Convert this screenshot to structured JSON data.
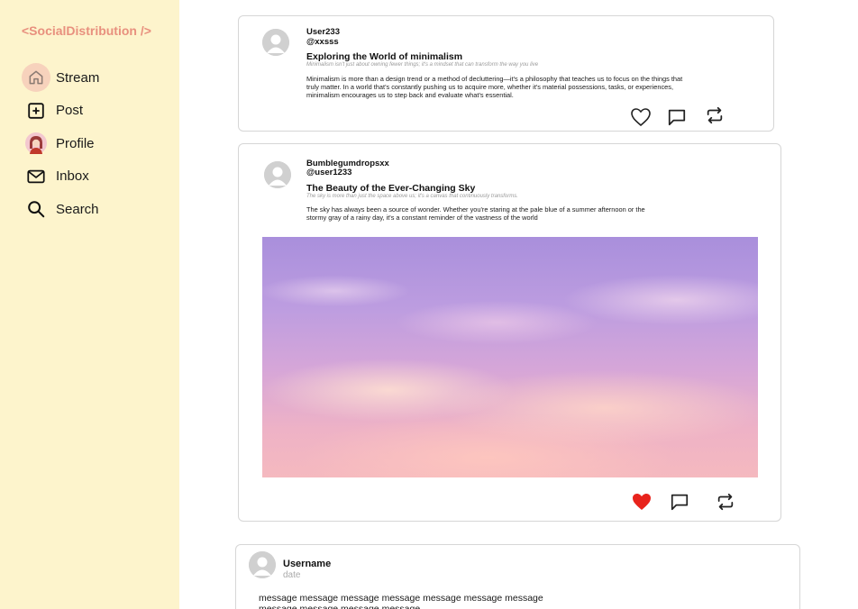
{
  "app": {
    "brand": "<SocialDistribution />"
  },
  "nav": {
    "items": [
      {
        "label": "Stream",
        "icon": "home-icon",
        "active": true
      },
      {
        "label": "Post",
        "icon": "plus-square-icon"
      },
      {
        "label": "Profile",
        "icon": "profile-avatar-icon"
      },
      {
        "label": "Inbox",
        "icon": "mail-icon"
      },
      {
        "label": "Search",
        "icon": "search-icon"
      }
    ]
  },
  "posts": [
    {
      "display_name": "User233",
      "handle": "@xxsss",
      "title": "Exploring the World of minimalism",
      "subtitle": "Minimalism isn't just about owning fewer things; it's a mindset that can transform the way you live",
      "body": "Minimalism is more than a design trend or a method of decluttering—it's a philosophy that teaches us to focus on the things that truly matter. In a world that's constantly pushing us to acquire more, whether it's material possessions, tasks, or experiences, minimalism encourages us to step back and evaluate what's essential.",
      "liked": false
    },
    {
      "display_name": "Bumblegumdropsxx",
      "handle": "@user1233",
      "title": "The Beauty of the Ever-Changing Sky",
      "subtitle": "The sky is more than just the space above us; it's a canvas that continuously transforms.",
      "body": "The sky has always been a source of wonder. Whether you're staring at the pale blue of a summer afternoon or the stormy gray of a rainy day, it's a constant reminder of the vastness of the world",
      "image": "pink-purple-sky-photo",
      "liked": true
    }
  ],
  "comment": {
    "username": "Username",
    "date": "date",
    "message": "message message message message message message message message message message message"
  },
  "colors": {
    "sidebar_bg": "#fdf4cc",
    "brand": "#e8907e",
    "active_nav_bg": "#f7d2bc",
    "liked_heart": "#e8231c"
  }
}
